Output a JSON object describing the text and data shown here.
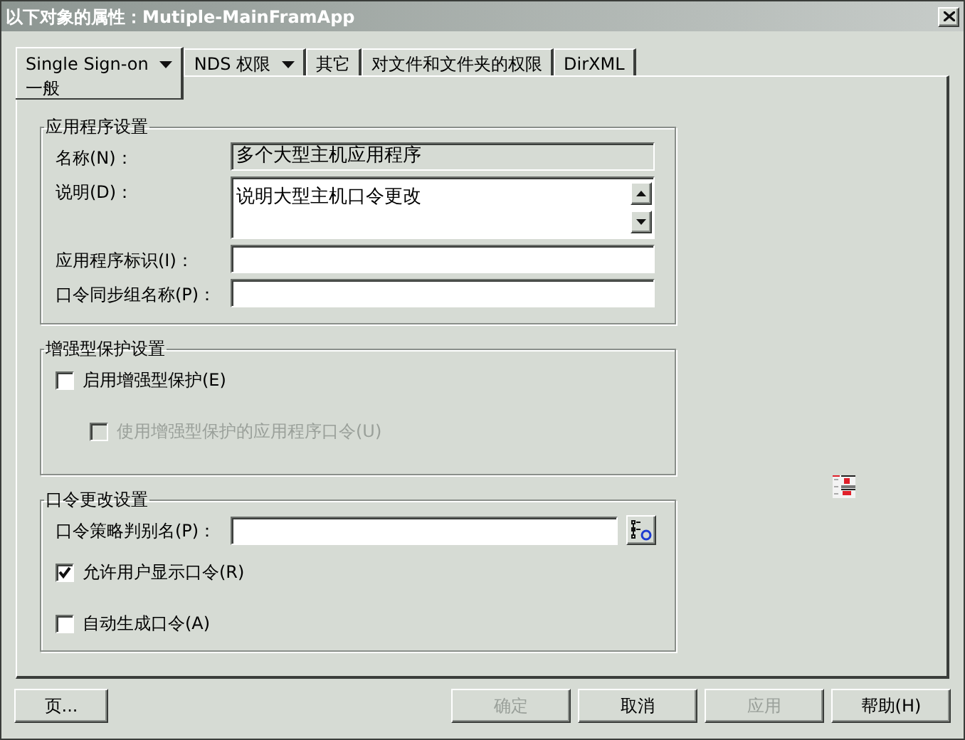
{
  "window": {
    "title": "以下对象的属性：Mutiple-MainFramApp"
  },
  "tabs": [
    {
      "label": "Single Sign-on",
      "dropdown": true,
      "selected": true
    },
    {
      "label": "NDS 权限",
      "dropdown": true,
      "selected": false
    },
    {
      "label": "其它",
      "dropdown": false,
      "selected": false
    },
    {
      "label": "对文件和文件夹的权限",
      "dropdown": false,
      "selected": false
    },
    {
      "label": "DirXML",
      "dropdown": false,
      "selected": false
    }
  ],
  "subtab": "一般",
  "app_settings": {
    "title": "应用程序设置",
    "fields": [
      {
        "kind": "readonly",
        "label": "名称(N)：",
        "value": "多个大型主机应用程序"
      },
      {
        "kind": "multiline",
        "label": "说明(D)：",
        "value": "说明大型主机口令更改"
      },
      {
        "kind": "text",
        "label": "应用程序标识(I)："
      },
      {
        "kind": "text",
        "label": "口令同步组名称(P)："
      }
    ]
  },
  "protection": {
    "title": "增强型保护设置",
    "options": [
      {
        "label": "启用增强型保护(E)",
        "checked": false,
        "disabled": false,
        "children": [
          {
            "label": "使用增强型保护的应用程序口令(U)",
            "checked": false,
            "disabled": true
          }
        ]
      }
    ]
  },
  "password_change": {
    "title": "口令更改设置",
    "policy_label": "口令策略判别名(P)：",
    "options": [
      {
        "label": "允许用户显示口令(R)",
        "checked": true,
        "disabled": false
      },
      {
        "label": "自动生成口令(A)",
        "checked": false,
        "disabled": false
      }
    ]
  },
  "left_buttons": [
    {
      "label": "页...",
      "disabled": false
    }
  ],
  "right_buttons": [
    {
      "label": "确定",
      "disabled": true
    },
    {
      "label": "取消",
      "disabled": false
    },
    {
      "label": "应用",
      "disabled": true
    },
    {
      "label": "帮助(H)",
      "disabled": false
    }
  ]
}
